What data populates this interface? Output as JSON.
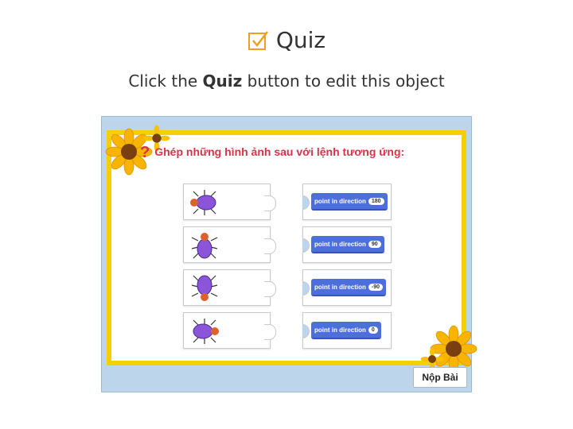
{
  "header": {
    "title": "Quiz",
    "subtitle_before": "Click the",
    "subtitle_bold": "Quiz",
    "subtitle_after": "button to edit this object"
  },
  "quiz": {
    "question": "Ghép những hình ảnh sau với lệnh tương ứng:",
    "left_items": [
      {
        "icon": "beetle-facing-left-icon"
      },
      {
        "icon": "beetle-facing-up-icon"
      },
      {
        "icon": "beetle-facing-down-icon"
      },
      {
        "icon": "beetle-facing-right-icon"
      }
    ],
    "right_items": [
      {
        "label": "point in direction",
        "value": "180"
      },
      {
        "label": "point in direction",
        "value": "90"
      },
      {
        "label": "point in direction",
        "value": "-90"
      },
      {
        "label": "point in direction",
        "value": "0"
      }
    ],
    "submit_label": "Nộp Bài"
  },
  "colors": {
    "panel_bg": "#bcd5ea",
    "frame_yellow": "#f5d000",
    "question_red": "#d9324a",
    "block_blue": "#4c6fdc"
  }
}
